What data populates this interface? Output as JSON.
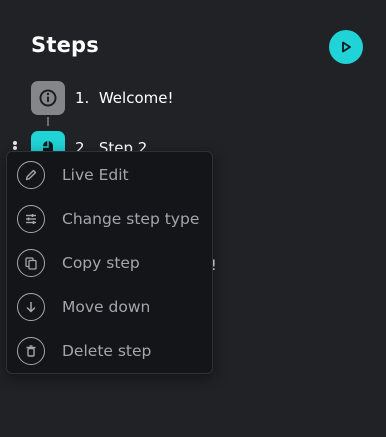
{
  "panel": {
    "title": "Steps",
    "accent_color": "#1fd3d7",
    "run_button_icon": "play-icon"
  },
  "steps": [
    {
      "number": "1.",
      "label": "Welcome!",
      "icon": "info-icon",
      "badge_color": "#85868a"
    },
    {
      "number": "2.",
      "label": "Step 2",
      "icon": "mouse-icon",
      "badge_color": "#1fd3d7"
    }
  ],
  "hidden_step_tail": "!",
  "context_menu": {
    "items": [
      {
        "label": "Live Edit",
        "icon": "pencil-icon"
      },
      {
        "label": "Change step type",
        "icon": "sliders-icon"
      },
      {
        "label": "Copy step",
        "icon": "copy-icon"
      },
      {
        "label": "Move down",
        "icon": "arrow-down-icon"
      },
      {
        "label": "Delete step",
        "icon": "trash-icon"
      }
    ]
  }
}
